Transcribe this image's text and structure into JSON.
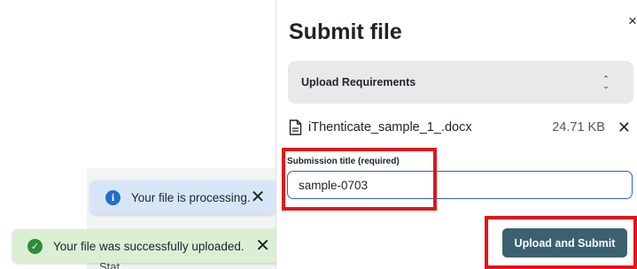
{
  "background": {
    "partial_text": "Stat"
  },
  "toasts": {
    "info": {
      "icon": "info-icon",
      "glyph": "i",
      "message": "Your file is processing.",
      "close_glyph": "✕",
      "color": "#d6e6f8"
    },
    "success": {
      "icon": "check-circle-icon",
      "glyph": "✓",
      "message": "Your file was successfully uploaded.",
      "close_glyph": "✕",
      "color": "#dbefd5"
    }
  },
  "panel": {
    "title": "Submit file",
    "close_glyph": "×",
    "requirements": {
      "label": "Upload Requirements",
      "chevron_up": "⌃",
      "chevron_down": "⌄"
    },
    "file": {
      "icon": "document-icon",
      "name": "iThenticate_sample_1_.docx",
      "size": "24.71 KB",
      "remove_glyph": "✕"
    },
    "title_field": {
      "label": "Submission title (required)",
      "value": "sample-0703"
    },
    "submit_label": "Upload and Submit"
  },
  "colors": {
    "primary_button": "#3b6170",
    "input_focus": "#2f64c8",
    "highlight": "#e0161b"
  }
}
